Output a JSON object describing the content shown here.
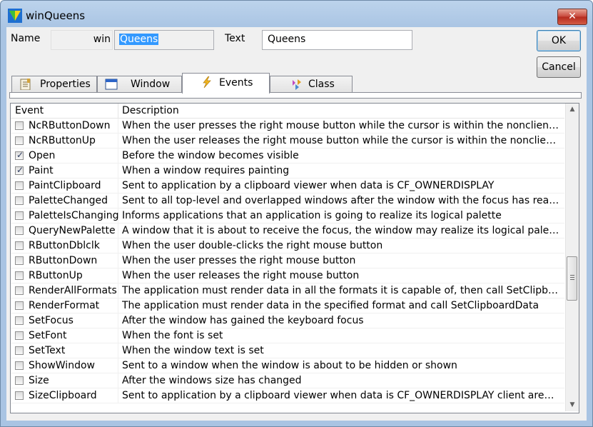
{
  "window": {
    "title": "winQueens",
    "close_glyph": "✕",
    "icon": "app-icon"
  },
  "header": {
    "name_label": "Name",
    "name_prefix": "win",
    "name_value": "Queens",
    "text_label": "Text",
    "text_value": "Queens"
  },
  "buttons": {
    "ok": "OK",
    "cancel": "Cancel"
  },
  "tabs": [
    {
      "label": "Properties",
      "icon": "properties-icon",
      "active": false
    },
    {
      "label": "Window",
      "icon": "window-icon",
      "active": false
    },
    {
      "label": "Events",
      "icon": "lightning-icon",
      "active": true
    },
    {
      "label": "Class",
      "icon": "class-icon",
      "active": false
    }
  ],
  "grid": {
    "columns": [
      "Event",
      "Description"
    ],
    "rows": [
      {
        "event": "NcRButtonDown",
        "checked": false,
        "description": "When the user presses the right mouse button while the cursor is within the nonclient area of ..."
      },
      {
        "event": "NcRButtonUp",
        "checked": false,
        "description": "When the user releases the right mouse button while the cursor is within the nonclient area of..."
      },
      {
        "event": "Open",
        "checked": true,
        "description": "Before the window becomes visible"
      },
      {
        "event": "Paint",
        "checked": true,
        "description": "When a window requires painting"
      },
      {
        "event": "PaintClipboard",
        "checked": false,
        "description": "Sent to application by a clipboard viewer when data is CF_OWNERDISPLAY"
      },
      {
        "event": "PaletteChanged",
        "checked": false,
        "description": "Sent to all top-level and overlapped windows after the window with the focus has realized its l..."
      },
      {
        "event": "PaletteIsChanging",
        "checked": false,
        "description": "Informs applications that an application is going to realize its logical palette"
      },
      {
        "event": "QueryNewPalette",
        "checked": false,
        "description": "A window that it is about to receive the focus, the window may realize its logical palette"
      },
      {
        "event": "RButtonDblclk",
        "checked": false,
        "description": "When the user double-clicks the right mouse button"
      },
      {
        "event": "RButtonDown",
        "checked": false,
        "description": "When the user presses the right mouse button"
      },
      {
        "event": "RButtonUp",
        "checked": false,
        "description": "When the user releases the right mouse button"
      },
      {
        "event": "RenderAllFormats",
        "checked": false,
        "description": "The application must render data in all the formats it is capable of, then call SetClipboardData"
      },
      {
        "event": "RenderFormat",
        "checked": false,
        "description": "The application must render data in the specified format and call SetClipboardData"
      },
      {
        "event": "SetFocus",
        "checked": false,
        "description": "After the window has gained the keyboard focus"
      },
      {
        "event": "SetFont",
        "checked": false,
        "description": "When the font is set"
      },
      {
        "event": "SetText",
        "checked": false,
        "description": "When the window text is set"
      },
      {
        "event": "ShowWindow",
        "checked": false,
        "description": "Sent to a window when the window is about to be hidden or shown"
      },
      {
        "event": "Size",
        "checked": false,
        "description": "After the windows size has changed"
      },
      {
        "event": "SizeClipboard",
        "checked": false,
        "description": "Sent to application by a clipboard viewer when data is CF_OWNERDISPLAY client area has ..."
      }
    ]
  },
  "scrollbar": {
    "up_glyph": "▲",
    "down_glyph": "▼",
    "position": 0.52
  },
  "colors": {
    "selection": "#3399ff",
    "title_gradient": "#bcd3ec",
    "close_button": "#c7463a"
  }
}
